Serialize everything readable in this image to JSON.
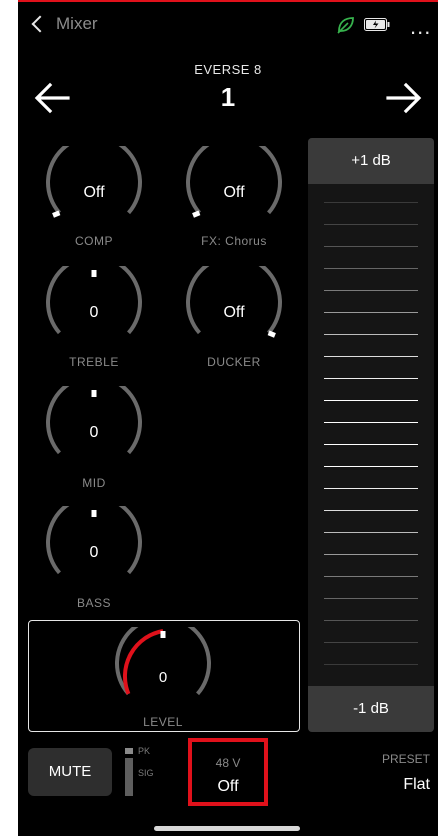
{
  "header": {
    "back_label": "Mixer",
    "status_icons": [
      "leaf-icon",
      "battery-charging-icon"
    ],
    "more_label": "..."
  },
  "device": {
    "name": "EVERSE 8",
    "channel": "1"
  },
  "knobs": {
    "comp": {
      "value": "Off",
      "label": "COMP"
    },
    "fx": {
      "value": "Off",
      "label": "FX: Chorus"
    },
    "treble": {
      "value": "0",
      "label": "TREBLE"
    },
    "ducker": {
      "value": "Off",
      "label": "DUCKER"
    },
    "mid": {
      "value": "0",
      "label": "MID"
    },
    "bass": {
      "value": "0",
      "label": "BASS"
    }
  },
  "level": {
    "value": "0",
    "label": "LEVEL"
  },
  "fader": {
    "top_label": "+1 dB",
    "bottom_label": "-1 dB"
  },
  "bottom": {
    "mute_label": "MUTE",
    "meter_pk": "PK",
    "meter_sig": "SIG",
    "phantom_label": "48 V",
    "phantom_value": "Off",
    "preset_label": "PRESET",
    "preset_value": "Flat"
  },
  "colors": {
    "accent": "#e0111b",
    "background": "#000000",
    "knob_track": "#6a6a6a",
    "indicator": "#ffffff"
  }
}
